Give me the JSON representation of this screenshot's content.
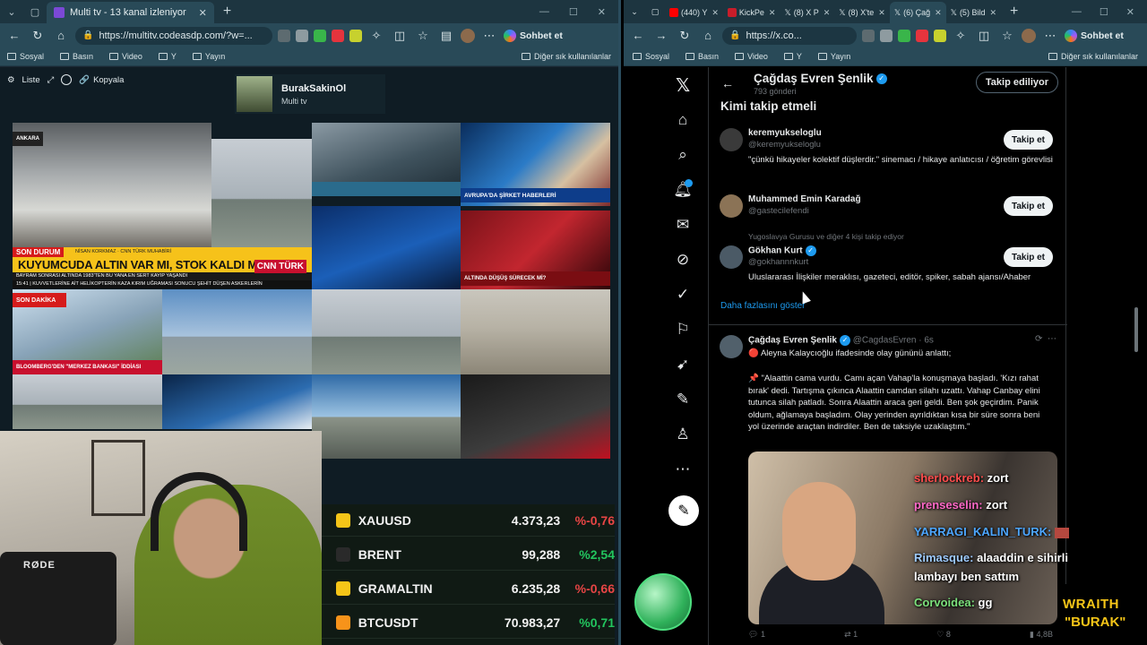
{
  "left_browser": {
    "tab_title": "Multi tv - 13 kanal izleniyor",
    "url": "https://multitv.codeasdp.com/?w=...",
    "chat_button": "Sohbet et",
    "bookmarks": [
      "Sosyal",
      "Basın",
      "Video",
      "Y",
      "Yayın"
    ],
    "bookmarks_right": "Diğer sık kullanılanlar"
  },
  "multitv": {
    "tools": {
      "list": "Liste",
      "copy": "Kopyala"
    },
    "profile_name": "BurakSakinOl",
    "profile_sub": "Multi tv",
    "tiles": {
      "ankara": "ANKARA",
      "haber1": "AVRUPA'DA ŞİRKET HABERLERİ",
      "sondakika": "SON DAKİKA",
      "bloomberg": "BLOOMBERG'DEN \"MERKEZ BANKASI\" İDDİASI",
      "altin": "ALTINDA DÜŞÜŞ SÜRECEK Mİ?"
    },
    "son_durum": {
      "label": "SON DURUM",
      "reporter": "NİSAN KORKMAZ · CNN TÜRK MUHABİRİ",
      "headline": "KUYUMCUDA ALTIN VAR MI, STOK KALDI MI?",
      "sub": "BAYRAM SONRASI ALTINDA 1983'TEN BU YANA EN SERT KAYIP YAŞANDI",
      "bottom": "15:41 | KUVVETLERİNE AİT HELİKOPTERİN KAZA KIRIM UĞRAMASI SONUCU ŞEHİT DÜŞEN ASKERLERİN",
      "logo": "CNN TÜRK"
    }
  },
  "market_ticker": [
    {
      "symbol": "XAUUSD",
      "price": "4.373,23",
      "change": "%-0,76",
      "dir": "neg",
      "color": "#f5c518"
    },
    {
      "symbol": "BRENT",
      "price": "99,288",
      "change": "%2,54",
      "dir": "pos",
      "color": "#2a2a2a"
    },
    {
      "symbol": "GRAMALTIN",
      "price": "6.235,28",
      "change": "%-0,66",
      "dir": "neg",
      "color": "#f5c518"
    },
    {
      "symbol": "BTCUSDT",
      "price": "70.983,27",
      "change": "%0,71",
      "dir": "pos",
      "color": "#f7931a"
    }
  ],
  "webcam": {
    "mic_brand": "RØDE"
  },
  "right_browser": {
    "tabs": [
      "(440) Y",
      "KickPe",
      "(8) X P",
      "(8) X'te",
      "(6) Çağ",
      "(5) Bild"
    ],
    "url": "https://x.co...",
    "chat_button": "Sohbet et",
    "bookmarks": [
      "Sosyal",
      "Basın",
      "Video",
      "Y",
      "Yayın"
    ],
    "bookmarks_right": "Diğer sık kullanılanlar"
  },
  "x": {
    "profile_name": "Çağdaş Evren Şenlik",
    "posts_count": "793 gönderi",
    "following_button": "Takip ediliyor",
    "who_to_follow": "Kimi takip etmeli",
    "suggestions": [
      {
        "name": "keremyukseloglu",
        "handle": "@keremyukseloglu",
        "bio": "\"çünkü hikayeler kolektif düşlerdir.\" sinemacı / hikaye anlatıcısı / öğretim görevlisi",
        "button": "Takip et"
      },
      {
        "name": "Muhammed Emin Karadağ",
        "handle": "@gastecilefendi",
        "bio": "",
        "button": "Takip et"
      },
      {
        "name": "Gökhan Kurt",
        "handle": "@gokhannnkurt",
        "bio": "Uluslararası İlişkiler meraklısı, gazeteci, editör, spiker, sabah ajansı/Ahaber",
        "context": "Yugoslavya Gurusu ve diğer 4 kişi takip ediyor",
        "button": "Takip et"
      }
    ],
    "show_more": "Daha fazlasını göster",
    "tweet": {
      "author": "Çağdaş Evren Şenlik",
      "handle": "@CagdasEvren",
      "time": "· 6s",
      "line1": "🔴 Aleyna Kalaycıoğlu ifadesinde olay gününü anlattı;",
      "body": "📌 \"Alaattin cama vurdu. Camı açan Vahap'la konuşmaya başladı. 'Kızı rahat bırak' dedi. Tartışma çıkınca Alaattin camdan silahı uzattı. Vahap Canbay elini tutunca silah patladı. Sonra Alaattin araca geri geldi. Ben şok geçirdim. Panik oldum, ağlamaya başladım. Olay yerinden ayrıldıktan kısa bir süre sonra beni yol üzerinde araçtan indirdiler. Ben de taksiyle uzaklaştım.\"",
      "replies": "1",
      "reposts": "1",
      "likes": "8",
      "views": "4,8B"
    }
  },
  "chat_overlay": [
    {
      "user": "sherlockreb:",
      "text": "zort",
      "color": "#ff4d4d"
    },
    {
      "user": "prenseselin:",
      "text": "zort",
      "color": "#ff69c7"
    },
    {
      "user": "YARRAGI_KALIN_TURK:",
      "text": "",
      "color": "#4da6ff"
    },
    {
      "user": "Rimasque:",
      "text": "alaaddin e sihirli",
      "color": "#9ecbff"
    },
    {
      "user": "",
      "text": "lambayı ben sattım",
      "color": "#ffffff"
    },
    {
      "user": "Corvoidea:",
      "text": "gg",
      "color": "#7be07b"
    }
  ],
  "streamer_badge": {
    "line1": "WRAITH",
    "line2": "\"BURAK\""
  }
}
